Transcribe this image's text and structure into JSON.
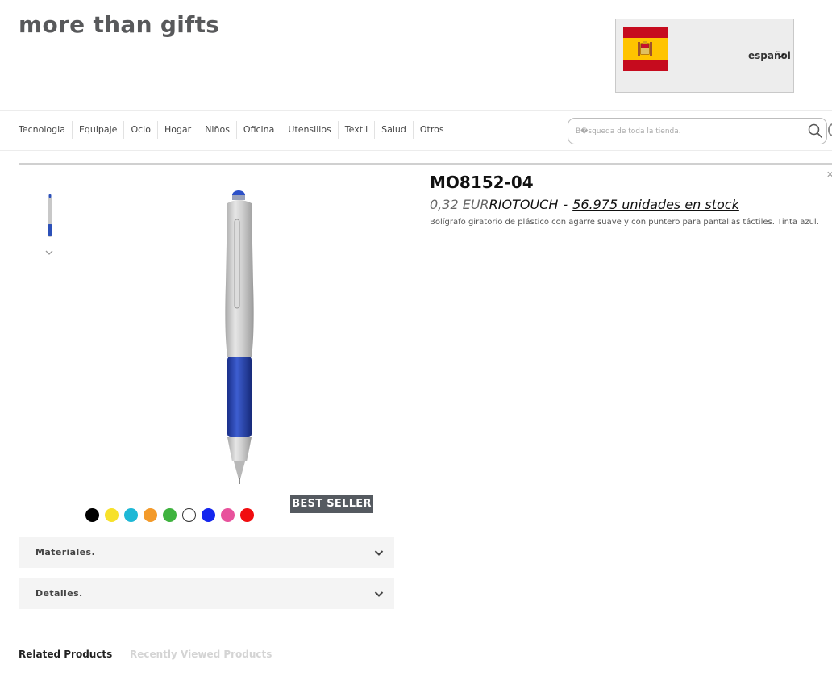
{
  "header": {
    "logo": "more than gifts",
    "language": {
      "label": "español"
    }
  },
  "nav": {
    "items": [
      "Tecnologia",
      "Equipaje",
      "Ocio",
      "Hogar",
      "Niños",
      "Oficina",
      "Utensilios",
      "Textil",
      "Salud",
      "Otros"
    ]
  },
  "search": {
    "placeholder": "B�squeda de toda la tienda."
  },
  "product": {
    "sku": "MO8152-04",
    "price": "0,32 EUR",
    "name": "RIOTOUCH",
    "separator": "-",
    "stock": "56.975 unidades en stock",
    "description": "Bolígrafo giratorio de plástico con agarre suave y con puntero para pantallas táctiles. Tinta azul.",
    "badge": "BEST SELLER",
    "swatches": [
      "#000000",
      "#f7e12a",
      "#1eb8d6",
      "#f39a2a",
      "#3fb33f",
      "#ffffff",
      "#1426ee",
      "#e8529c",
      "#f10d10"
    ]
  },
  "accordions": [
    {
      "label": "Materiales."
    },
    {
      "label": "Detalles."
    }
  ],
  "tabs": {
    "related": "Related Products",
    "recent": "Recently Viewed Products"
  },
  "icons": {
    "flag": "spain-flag-icon",
    "search": "search-icon",
    "thumb_scroll": "chevron-down-icon",
    "accordion": "chevron-down-icon"
  }
}
